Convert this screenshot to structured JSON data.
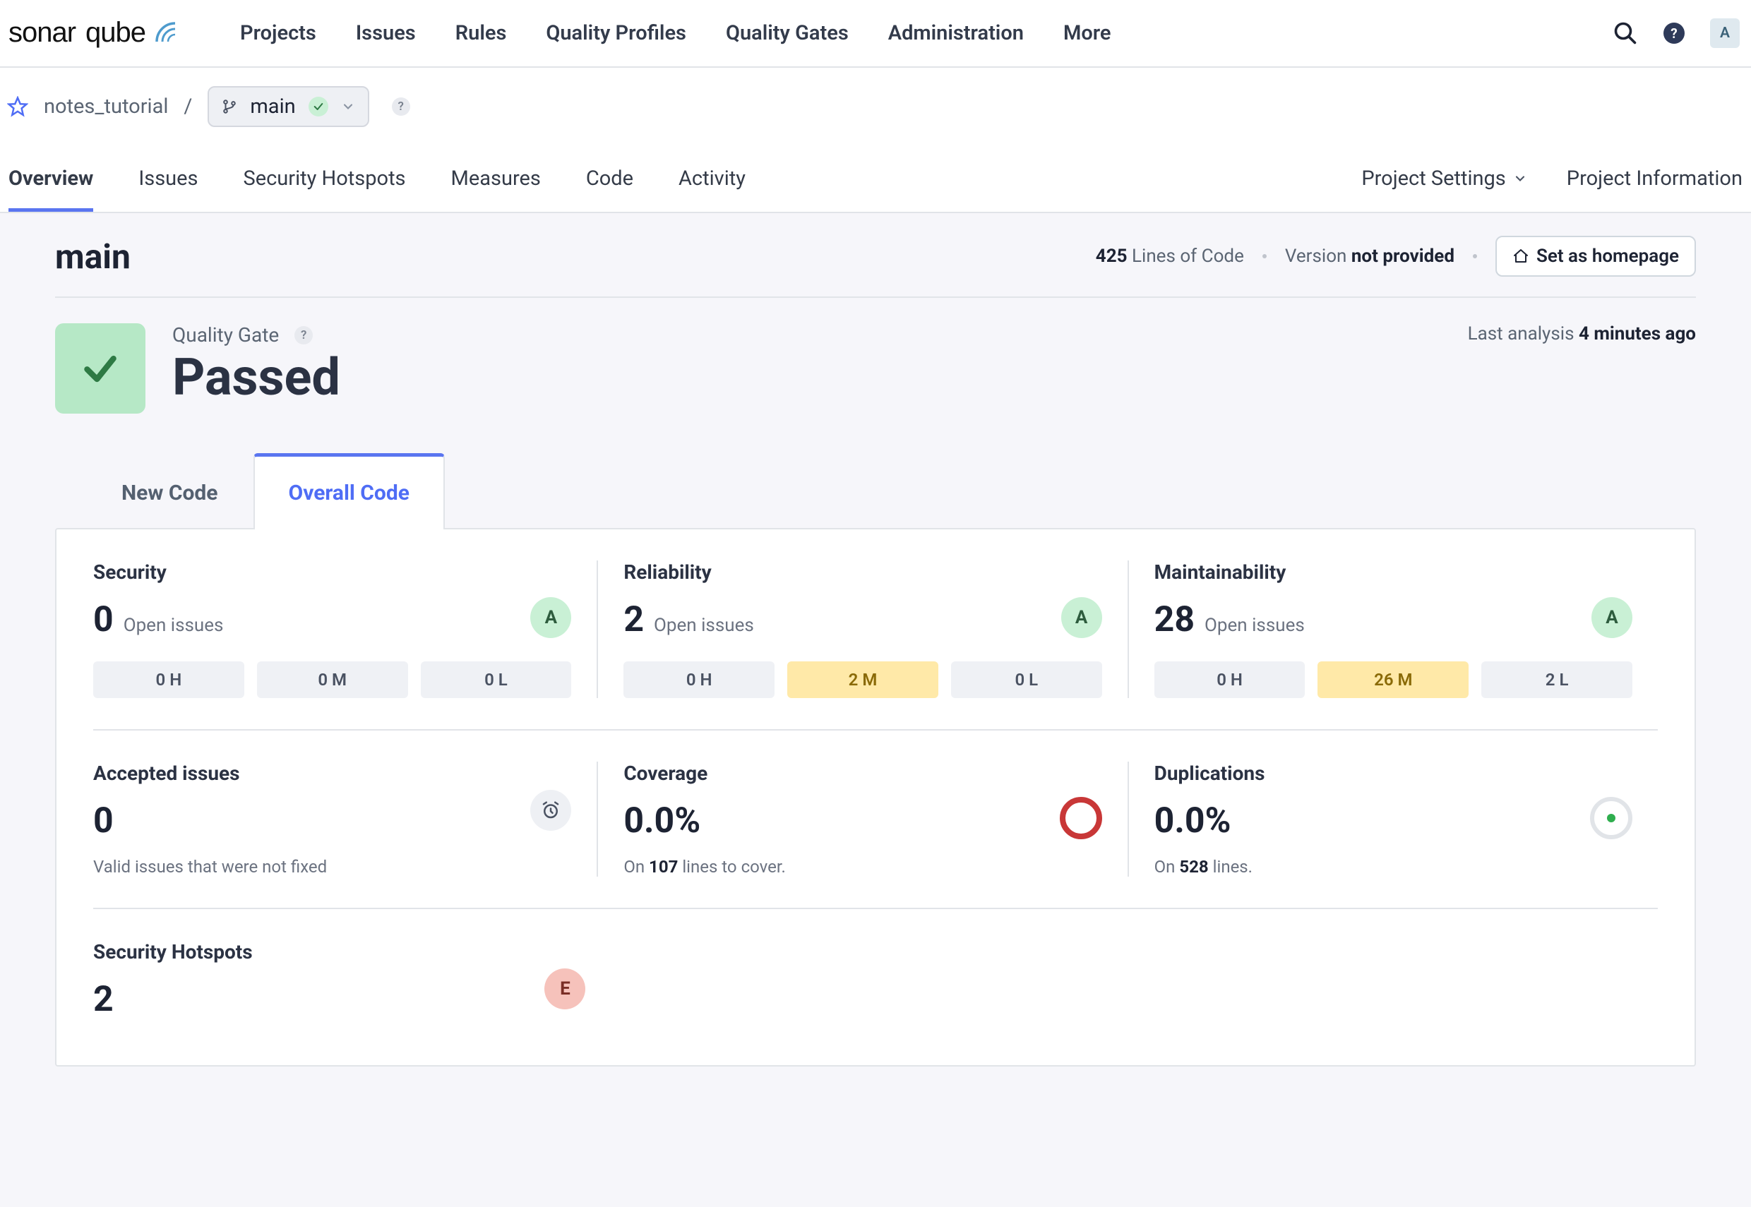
{
  "nav": {
    "items": [
      "Projects",
      "Issues",
      "Rules",
      "Quality Profiles",
      "Quality Gates",
      "Administration",
      "More"
    ],
    "help": "?",
    "user_initial": "A"
  },
  "breadcrumb": {
    "project": "notes_tutorial",
    "sep": "/",
    "branch": "main",
    "help": "?"
  },
  "project_tabs": {
    "items": [
      "Overview",
      "Issues",
      "Security Hotspots",
      "Measures",
      "Code",
      "Activity"
    ],
    "right": [
      "Project Settings",
      "Project Information"
    ],
    "active": "Overview"
  },
  "branch_header": {
    "title": "main",
    "loc_count": "425",
    "loc_label": "Lines of Code",
    "version_label": "Version",
    "version_value": "not provided",
    "set_home": "Set as homepage"
  },
  "quality_gate": {
    "label": "Quality Gate",
    "help": "?",
    "status": "Passed",
    "last_analysis_label": "Last analysis",
    "last_analysis_value": "4 minutes ago"
  },
  "code_tabs": {
    "new": "New Code",
    "overall": "Overall Code"
  },
  "metrics": {
    "security": {
      "title": "Security",
      "count": "0",
      "label": "Open issues",
      "grade": "A",
      "chips": [
        "0 H",
        "0 M",
        "0 L"
      ]
    },
    "reliability": {
      "title": "Reliability",
      "count": "2",
      "label": "Open issues",
      "grade": "A",
      "chips": [
        "0 H",
        "2 M",
        "0 L"
      ],
      "chip_warn_index": 1
    },
    "maintainability": {
      "title": "Maintainability",
      "count": "28",
      "label": "Open issues",
      "grade": "A",
      "chips": [
        "0 H",
        "26 M",
        "2 L"
      ],
      "chip_warn_index": 1
    },
    "accepted": {
      "title": "Accepted issues",
      "count": "0",
      "note": "Valid issues that were not fixed"
    },
    "coverage": {
      "title": "Coverage",
      "value": "0.0%",
      "note_prefix": "On ",
      "note_strong": "107",
      "note_suffix": " lines to cover."
    },
    "duplications": {
      "title": "Duplications",
      "value": "0.0%",
      "note_prefix": "On ",
      "note_strong": "528",
      "note_suffix": " lines."
    },
    "hotspots": {
      "title": "Security Hotspots",
      "count": "2",
      "grade": "E"
    }
  }
}
